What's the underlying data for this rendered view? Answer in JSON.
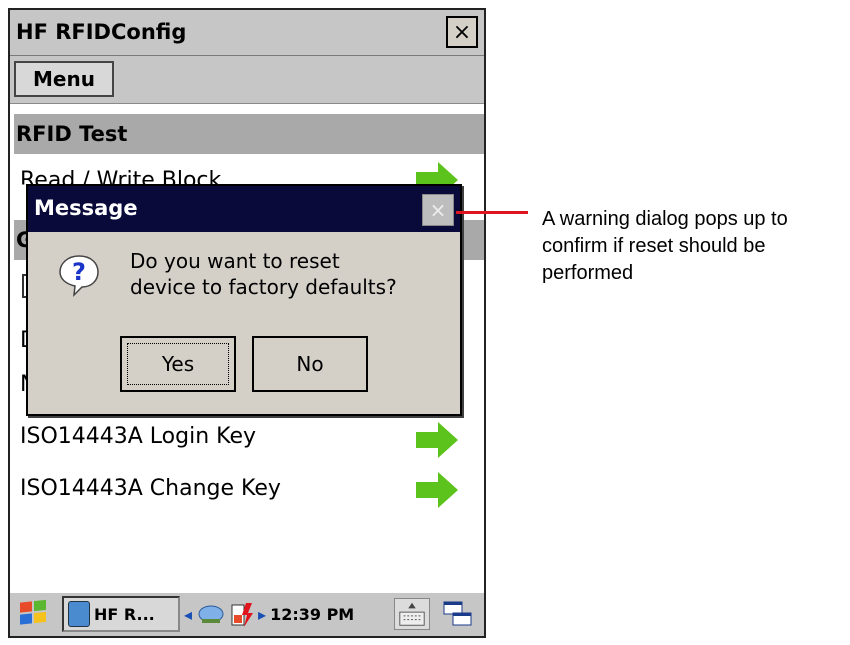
{
  "window": {
    "title": "HF RFIDConfig",
    "close_label": "×"
  },
  "menubar": {
    "menu_label": "Menu"
  },
  "sections": {
    "rfid_test": "RFID Test"
  },
  "items": {
    "read_write_block": "Read / Write Block",
    "login_key": "ISO14443A Login Key",
    "change_key": "ISO14443A Change Key",
    "partial_g": "G",
    "partial_d": "D",
    "partial_n": "N"
  },
  "dialog": {
    "title": "Message",
    "close_label": "×",
    "message": "Do you want to reset\ndevice to factory defaults?",
    "yes_label": "Yes",
    "no_label": "No"
  },
  "taskbar": {
    "app_label": "HF R...",
    "time": "12:39 PM"
  },
  "annotation": {
    "text": "A warning dialog pops up to confirm if reset should be performed"
  },
  "colors": {
    "accent_red": "#e0141e",
    "arrow_green": "#5cc21c",
    "dialog_title_bg": "#0a0a3a"
  }
}
